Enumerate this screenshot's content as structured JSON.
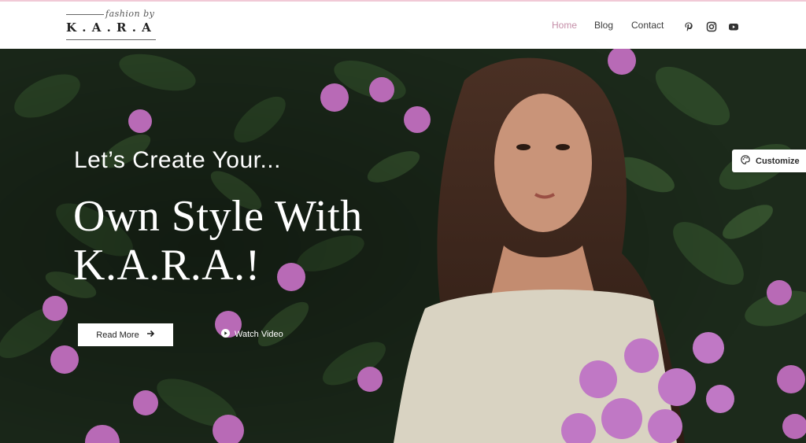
{
  "brand": {
    "script": "fashion by",
    "name": "K . A . R . A"
  },
  "nav": {
    "items": [
      {
        "label": "Home",
        "active": true
      },
      {
        "label": "Blog",
        "active": false
      },
      {
        "label": "Contact",
        "active": false
      }
    ],
    "social_icons": [
      "pinterest-icon",
      "instagram-icon",
      "youtube-icon"
    ]
  },
  "hero": {
    "kicker": "Let’s Create Your...",
    "title_line1": "Own Style With",
    "title_line2": "K.A.R.A.!",
    "read_more_label": "Read More",
    "watch_video_label": "Watch Video"
  },
  "customize": {
    "label": "Customize"
  },
  "colors": {
    "accent": "#c58ea8",
    "top_border": "#f1c9d6",
    "foliage_dark": "#1c2a1b",
    "flower": "#b86ab6"
  }
}
